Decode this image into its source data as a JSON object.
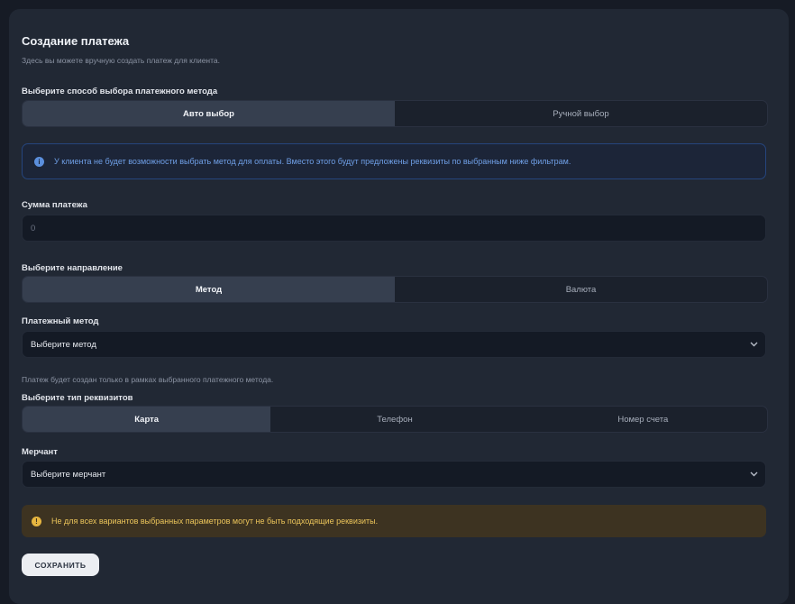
{
  "page": {
    "title": "Создание платежа",
    "subtitle": "Здесь вы можете вручную создать платеж для клиента."
  },
  "selection_mode": {
    "label": "Выберите способ выбора платежного метода",
    "options": [
      "Авто выбор",
      "Ручной выбор"
    ],
    "selected": "Авто выбор"
  },
  "info_notice": {
    "icon": "info-icon",
    "color": "#6f9fe6",
    "text": "У клиента не будет возможности выбрать метод для оплаты. Вместо этого будут предложены реквизиты по выбранным ниже фильтрам."
  },
  "amount": {
    "label": "Сумма платежа",
    "value": "0"
  },
  "direction": {
    "label": "Выберите направление",
    "options": [
      "Метод",
      "Валюта"
    ],
    "selected": "Метод"
  },
  "payment_method": {
    "label": "Платежный метод",
    "value": "Выберите метод",
    "hint": "Платеж будет создан только в рамках выбранного платежного метода."
  },
  "requisites_type": {
    "label": "Выберите тип реквизитов",
    "options": [
      "Карта",
      "Телефон",
      "Номер счета"
    ],
    "selected": "Карта"
  },
  "merchant": {
    "label": "Мерчант",
    "value": "Выберите мерчант"
  },
  "warning_notice": {
    "icon": "warning-icon",
    "color": "#ecc55a",
    "text": "Не для всех вариантов выбранных параметров могут не быть подходящие реквизиты."
  },
  "actions": {
    "save_label": "СОХРАНИТЬ"
  }
}
